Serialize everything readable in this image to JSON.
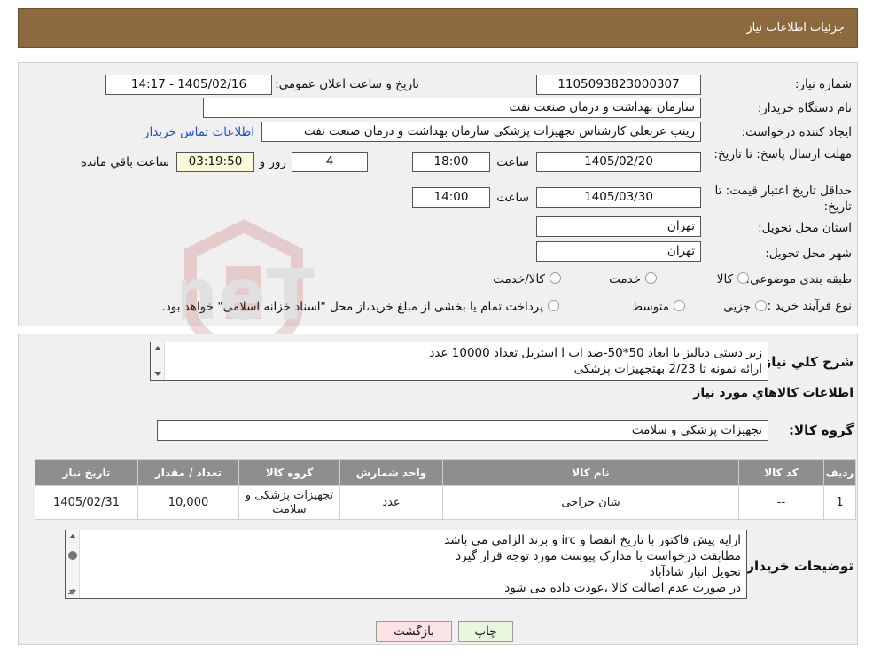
{
  "header": {
    "title": "جزئیات اطلاعات نیاز"
  },
  "fields": {
    "need_number_label": "شماره نیاز:",
    "need_number": "1105093823000307",
    "announce_label": "تاریخ و ساعت اعلان عمومی:",
    "announce_value": "1405/02/16 - 14:17",
    "buyer_org_label": "نام دستگاه خریدار:",
    "buyer_org": "سازمان بهداشت و درمان صنعت نفت",
    "creator_label": "ایجاد کننده درخواست:",
    "creator": "زینب عربعلی کارشناس تجهیزات پزشکی سازمان بهداشت و درمان صنعت نفت",
    "contact_link": "اطلاعات تماس خریدار",
    "deadline_label": "مهلت ارسال پاسخ: تا تاریخ:",
    "deadline_date": "1405/02/20",
    "time_label": "ساعت",
    "deadline_time": "18:00",
    "days_value": "4",
    "days_label": "روز و",
    "remaining_time": "03:19:50",
    "remaining_label": "ساعت باقي مانده",
    "min_validity_label": "حداقل تاريخ اعتبار قيمت: تا تاريخ:",
    "validity_date": "1405/03/30",
    "validity_time": "14:00",
    "province_label": "استان محل تحویل:",
    "province": "تهران",
    "city_label": "شهر محل تحویل:",
    "city": "تهران",
    "category_label": "طبقه بندی موضوعی:",
    "category_options": [
      "کالا",
      "خدمت",
      "کالا/خدمت"
    ],
    "process_label": "نوع فرآیند خرید :",
    "process_options": [
      "جزیی",
      "متوسط"
    ],
    "process_note": "پرداخت تمام یا بخشی از مبلغ خرید،از محل \"اسناد خزانه اسلامی\" خواهد بود."
  },
  "description": {
    "label": "شرح کلي نياز:",
    "lines": [
      "زیر دستی دیالیز با ابعاد 50*50-ضد اب ا استریل  تعداد 10000 عدد",
      "ارائه نمونه تا 2/23 بهتجهیزات پزشکی"
    ]
  },
  "goods_info_title": "اطلاعات کالاهاي مورد نياز",
  "goods_group": {
    "label": "گروه کالا:",
    "value": "تجهیزات پزشکی و سلامت"
  },
  "table": {
    "headers": [
      "رديف",
      "کد کالا",
      "نام کالا",
      "واحد شمارش",
      "گروه کالا",
      "تعداد / مقدار",
      "تاريخ نياز"
    ],
    "rows": [
      [
        "1",
        "--",
        "شان جراحی",
        "عدد",
        "تجهیزات پزشکی و سلامت",
        "10,000",
        "1405/02/31"
      ]
    ]
  },
  "buyer_notes": {
    "label": "توضيحات خريدار:",
    "lines": [
      "ارایه  پیش فاکتور با تاریخ انقضا و irc  و برند الزامی می باشد",
      "مطابقت درخواست با مدارک پیوست مورد توجه قرار گیرد",
      "تحویل انبار شادآباد",
      "در صورت عدم اصالت کالا ،عودت داده می شود"
    ]
  },
  "buttons": {
    "print": "چاپ",
    "back": "بازگشت"
  },
  "colors": {
    "header_bg": "#8c6a3e",
    "table_header_bg": "#8e8e8e",
    "link": "#1a4fd6",
    "back_btn_bg": "#fbe3e3",
    "print_btn_bg": "#e6f6df"
  }
}
